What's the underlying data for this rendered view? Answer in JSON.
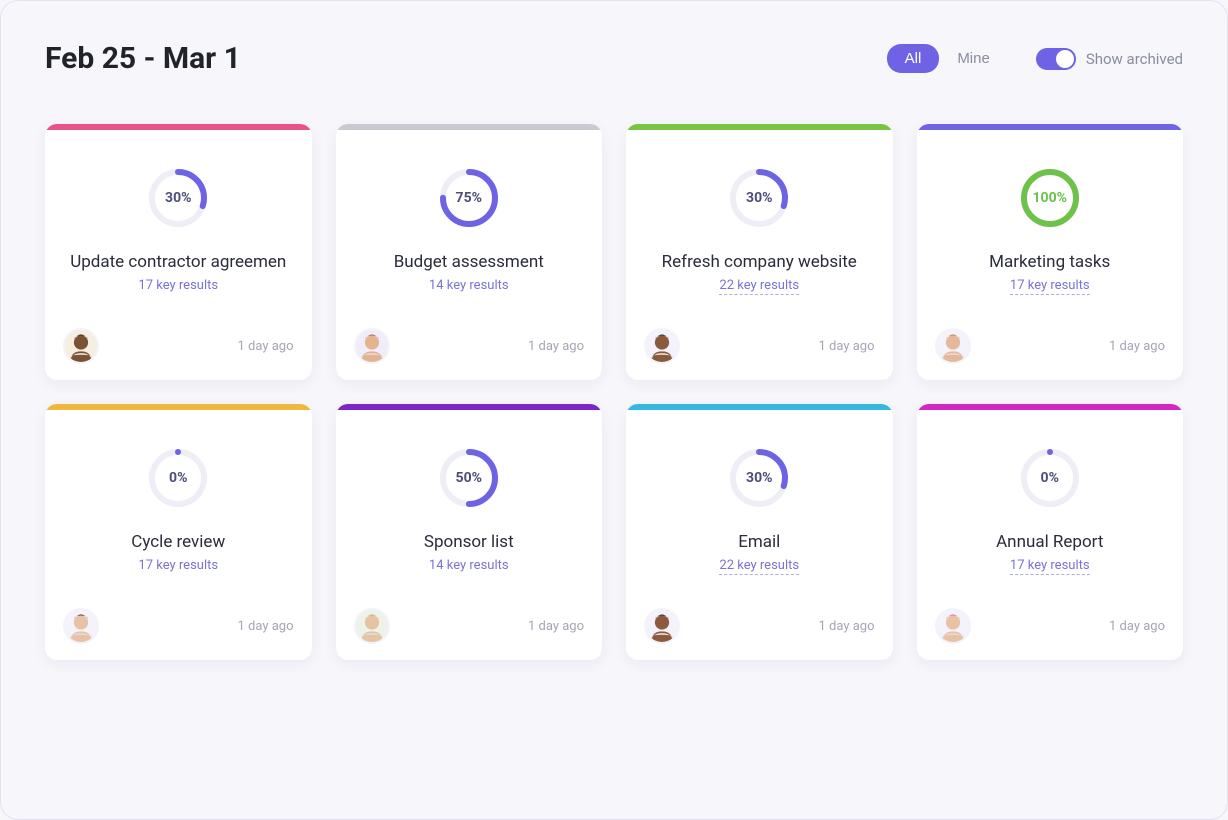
{
  "header": {
    "date_range": "Feb 25 - Mar 1",
    "filter_all": "All",
    "filter_mine": "Mine",
    "archived_label": "Show archived"
  },
  "colors": {
    "progress_ring": "#6e62e5",
    "progress_ring_done": "#6cc24a"
  },
  "cards": [
    {
      "stripe": "#e85286",
      "percent": 30,
      "percent_label": "30%",
      "title": "Update contractor agreemen",
      "key_results": "17 key results",
      "underlined": false,
      "timestamp": "1 day ago",
      "avatar": {
        "skin": "#7a5234",
        "hair": "#1b1b1b",
        "bg": "#f6efe0"
      }
    },
    {
      "stripe": "#c9c9d2",
      "percent": 75,
      "percent_label": "75%",
      "title": "Budget assessment",
      "key_results": "14 key results",
      "underlined": false,
      "timestamp": "1 day ago",
      "avatar": {
        "skin": "#e3b48f",
        "hair": "#8d5a3a",
        "bg": "#f0edf8"
      }
    },
    {
      "stripe": "#78c543",
      "percent": 30,
      "percent_label": "30%",
      "title": "Refresh company website",
      "key_results": "22 key results",
      "underlined": true,
      "timestamp": "1 day ago",
      "avatar": {
        "skin": "#8a5a3c",
        "hair": "#1c1c1c",
        "bg": "#f4f2fb"
      }
    },
    {
      "stripe": "#6e62e5",
      "percent": 100,
      "percent_label": "100%",
      "title": "Marketing tasks",
      "key_results": "17 key results",
      "underlined": true,
      "timestamp": "1 day ago",
      "avatar": {
        "skin": "#e6b899",
        "hair": "#a2794e",
        "bg": "#f4f2fb"
      }
    },
    {
      "stripe": "#f0b73f",
      "percent": 0,
      "percent_label": "0%",
      "title": "Cycle review",
      "key_results": "17 key results",
      "underlined": false,
      "timestamp": "1 day ago",
      "avatar": {
        "skin": "#e9c2a6",
        "hair": "#3b2516",
        "bg": "#f4f2fb"
      }
    },
    {
      "stripe": "#7b26c9",
      "percent": 50,
      "percent_label": "50%",
      "title": "Sponsor list",
      "key_results": "14 key results",
      "underlined": false,
      "timestamp": "1 day ago",
      "avatar": {
        "skin": "#e8c3a2",
        "hair": "#c9a46c",
        "bg": "#eef3ea"
      }
    },
    {
      "stripe": "#35b8e0",
      "percent": 30,
      "percent_label": "30%",
      "title": "Email",
      "key_results": "22 key results",
      "underlined": true,
      "timestamp": "1 day ago",
      "avatar": {
        "skin": "#8e5a3d",
        "hair": "#1e1e1e",
        "bg": "#f4f2fb"
      }
    },
    {
      "stripe": "#d327c4",
      "percent": 0,
      "percent_label": "0%",
      "title": "Annual Report",
      "key_results": "17 key results",
      "underlined": true,
      "timestamp": "1 day ago",
      "avatar": {
        "skin": "#e9c2a6",
        "hair": "#de5fa1",
        "bg": "#f4f2fb"
      }
    }
  ]
}
